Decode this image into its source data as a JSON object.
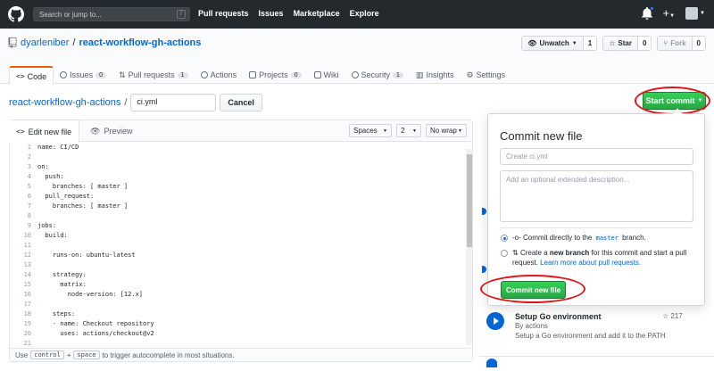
{
  "header": {
    "search_placeholder": "Search or jump to...",
    "search_key": "/",
    "nav": [
      "Pull requests",
      "Issues",
      "Marketplace",
      "Explore"
    ]
  },
  "repo": {
    "owner": "dyarleniber",
    "separator": "/",
    "name": "react-workflow-gh-actions",
    "unwatch_label": "Unwatch",
    "unwatch_count": "1",
    "star_label": "Star",
    "star_count": "0",
    "fork_label": "Fork",
    "fork_count": "0"
  },
  "tabs": [
    {
      "label": "Code",
      "count": ""
    },
    {
      "label": "Issues",
      "count": "0"
    },
    {
      "label": "Pull requests",
      "count": "1"
    },
    {
      "label": "Actions",
      "count": ""
    },
    {
      "label": "Projects",
      "count": "0"
    },
    {
      "label": "Wiki",
      "count": ""
    },
    {
      "label": "Security",
      "count": "1"
    },
    {
      "label": "Insights",
      "count": ""
    },
    {
      "label": "Settings",
      "count": ""
    }
  ],
  "breadcrumb": {
    "repo": "react-workflow-gh-actions",
    "sep": "/",
    "filename": "ci.yml",
    "cancel_label": "Cancel"
  },
  "start_commit_label": "Start commit",
  "editor": {
    "edit_tab": "Edit new file",
    "preview_tab": "Preview",
    "indent_mode": "Spaces",
    "indent_size": "2",
    "wrap_mode": "No wrap",
    "lines": [
      "name: CI/CD",
      "",
      "on:",
      "  push:",
      "    branches: [ master ]",
      "  pull_request:",
      "    branches: [ master ]",
      "",
      "jobs:",
      "  build:",
      "",
      "    runs-on: ubuntu-latest",
      "",
      "    strategy:",
      "      matrix:",
      "        node-version: [12.x]",
      "",
      "    steps:",
      "    - name: Checkout repository",
      "      uses: actions/checkout@v2",
      ""
    ],
    "footer_use": "Use",
    "footer_key1": "control",
    "footer_plus": "+",
    "footer_key2": "space",
    "footer_text": "to trigger autocomplete in most situations."
  },
  "commit": {
    "title": "Commit new file",
    "summary_placeholder": "Create ci.yml",
    "desc_placeholder": "Add an optional extended description...",
    "opt1_prefix": "Commit directly to the",
    "opt1_branch": "master",
    "opt1_suffix": "branch.",
    "opt2_pre": "Create a",
    "opt2_bold": "new branch",
    "opt2_post": "for this commit and start a pull request.",
    "opt2_link": "Learn more about pull requests.",
    "button_label": "Commit new file"
  },
  "marketplace": {
    "title": "Setup Go environment",
    "by": "By actions",
    "desc": "Setup a Go environment and add it to the PATH",
    "stars": "217"
  },
  "colors": {
    "header_bg": "#24292e",
    "link": "#0366d6",
    "green": "#28a745",
    "annotation_red": "#e3151a"
  }
}
